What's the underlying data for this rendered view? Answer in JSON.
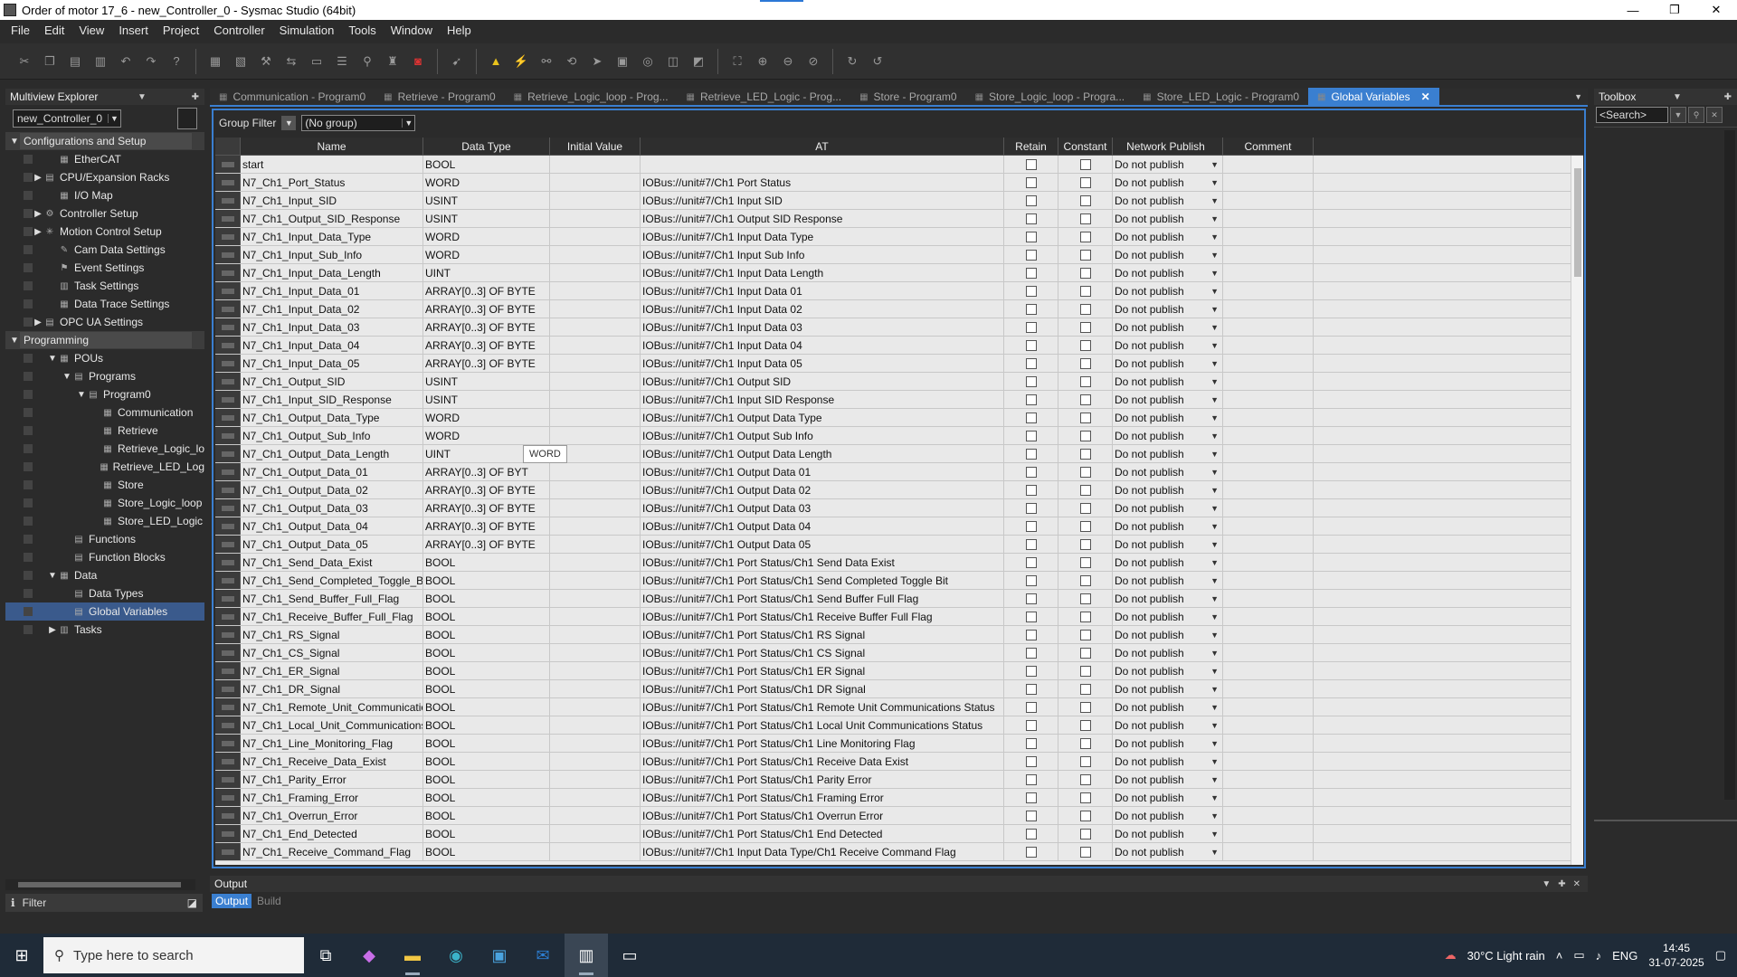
{
  "window": {
    "title": "Order of motor 17_6 - new_Controller_0 - Sysmac Studio (64bit)",
    "minimize": "—",
    "maximize": "❐",
    "close": "✕"
  },
  "menu": [
    "File",
    "Edit",
    "View",
    "Insert",
    "Project",
    "Controller",
    "Simulation",
    "Tools",
    "Window",
    "Help"
  ],
  "explorer": {
    "title": "Multiview Explorer",
    "controller": "new_Controller_0",
    "tree": [
      {
        "label": "Configurations and Setup",
        "level": 0,
        "arrow": "▼",
        "section": true,
        "icon": ""
      },
      {
        "label": "EtherCAT",
        "level": 2,
        "arrow": "",
        "icon": "▦"
      },
      {
        "label": "CPU/Expansion Racks",
        "level": 1,
        "arrow": "▶",
        "icon": "▤"
      },
      {
        "label": "I/O Map",
        "level": 2,
        "arrow": "",
        "icon": "▦"
      },
      {
        "label": "Controller Setup",
        "level": 1,
        "arrow": "▶",
        "icon": "⚙"
      },
      {
        "label": "Motion Control Setup",
        "level": 1,
        "arrow": "▶",
        "icon": "✳"
      },
      {
        "label": "Cam Data Settings",
        "level": 2,
        "arrow": "",
        "icon": "✎"
      },
      {
        "label": "Event Settings",
        "level": 2,
        "arrow": "",
        "icon": "⚑"
      },
      {
        "label": "Task Settings",
        "level": 2,
        "arrow": "",
        "icon": "▥"
      },
      {
        "label": "Data Trace Settings",
        "level": 2,
        "arrow": "",
        "icon": "▦"
      },
      {
        "label": "OPC UA Settings",
        "level": 1,
        "arrow": "▶",
        "icon": "▤"
      },
      {
        "label": "Programming",
        "level": 0,
        "arrow": "▼",
        "section": true,
        "icon": ""
      },
      {
        "label": "POUs",
        "level": 2,
        "arrow": "▼",
        "icon": "▦"
      },
      {
        "label": "Programs",
        "level": 3,
        "arrow": "▼",
        "icon": "▤"
      },
      {
        "label": "Program0",
        "level": 4,
        "arrow": "▼",
        "icon": "▤"
      },
      {
        "label": "Communication",
        "level": 5,
        "arrow": "",
        "icon": "▦"
      },
      {
        "label": "Retrieve",
        "level": 5,
        "arrow": "",
        "icon": "▦"
      },
      {
        "label": "Retrieve_Logic_lo",
        "level": 5,
        "arrow": "",
        "icon": "▦"
      },
      {
        "label": "Retrieve_LED_Log",
        "level": 5,
        "arrow": "",
        "icon": "▦"
      },
      {
        "label": "Store",
        "level": 5,
        "arrow": "",
        "icon": "▦"
      },
      {
        "label": "Store_Logic_loop",
        "level": 5,
        "arrow": "",
        "icon": "▦"
      },
      {
        "label": "Store_LED_Logic",
        "level": 5,
        "arrow": "",
        "icon": "▦"
      },
      {
        "label": "Functions",
        "level": 3,
        "arrow": "",
        "icon": "▤"
      },
      {
        "label": "Function Blocks",
        "level": 3,
        "arrow": "",
        "icon": "▤"
      },
      {
        "label": "Data",
        "level": 2,
        "arrow": "▼",
        "icon": "▦"
      },
      {
        "label": "Data Types",
        "level": 3,
        "arrow": "",
        "icon": "▤"
      },
      {
        "label": "Global Variables",
        "level": 3,
        "arrow": "",
        "icon": "▤",
        "selected": true
      },
      {
        "label": "Tasks",
        "level": 2,
        "arrow": "▶",
        "icon": "▥"
      }
    ],
    "filter": "Filter"
  },
  "tabs": [
    {
      "label": "Communication - Program0",
      "active": false
    },
    {
      "label": "Retrieve - Program0",
      "active": false
    },
    {
      "label": "Retrieve_Logic_loop - Prog...",
      "active": false
    },
    {
      "label": "Retrieve_LED_Logic - Prog...",
      "active": false
    },
    {
      "label": "Store - Program0",
      "active": false
    },
    {
      "label": "Store_Logic_loop - Progra...",
      "active": false
    },
    {
      "label": "Store_LED_Logic - Program0",
      "active": false
    },
    {
      "label": "Global Variables",
      "active": true
    }
  ],
  "group_filter": {
    "label": "Group Filter",
    "value": "(No group)"
  },
  "columns": [
    "Name",
    "Data Type",
    "Initial Value",
    "AT",
    "Retain",
    "Constant",
    "Network Publish",
    "Comment"
  ],
  "rows": [
    {
      "name": "start",
      "type": "BOOL",
      "at": ""
    },
    {
      "name": "N7_Ch1_Port_Status",
      "type": "WORD",
      "at": "IOBus://unit#7/Ch1 Port Status"
    },
    {
      "name": "N7_Ch1_Input_SID",
      "type": "USINT",
      "at": "IOBus://unit#7/Ch1 Input SID"
    },
    {
      "name": "N7_Ch1_Output_SID_Response",
      "type": "USINT",
      "at": "IOBus://unit#7/Ch1 Output SID Response"
    },
    {
      "name": "N7_Ch1_Input_Data_Type",
      "type": "WORD",
      "at": "IOBus://unit#7/Ch1 Input Data Type"
    },
    {
      "name": "N7_Ch1_Input_Sub_Info",
      "type": "WORD",
      "at": "IOBus://unit#7/Ch1 Input Sub Info"
    },
    {
      "name": "N7_Ch1_Input_Data_Length",
      "type": "UINT",
      "at": "IOBus://unit#7/Ch1 Input Data Length"
    },
    {
      "name": "N7_Ch1_Input_Data_01",
      "type": "ARRAY[0..3] OF BYTE",
      "at": "IOBus://unit#7/Ch1 Input Data 01"
    },
    {
      "name": "N7_Ch1_Input_Data_02",
      "type": "ARRAY[0..3] OF BYTE",
      "at": "IOBus://unit#7/Ch1 Input Data 02"
    },
    {
      "name": "N7_Ch1_Input_Data_03",
      "type": "ARRAY[0..3] OF BYTE",
      "at": "IOBus://unit#7/Ch1 Input Data 03"
    },
    {
      "name": "N7_Ch1_Input_Data_04",
      "type": "ARRAY[0..3] OF BYTE",
      "at": "IOBus://unit#7/Ch1 Input Data 04"
    },
    {
      "name": "N7_Ch1_Input_Data_05",
      "type": "ARRAY[0..3] OF BYTE",
      "at": "IOBus://unit#7/Ch1 Input Data 05"
    },
    {
      "name": "N7_Ch1_Output_SID",
      "type": "USINT",
      "at": "IOBus://unit#7/Ch1 Output SID"
    },
    {
      "name": "N7_Ch1_Input_SID_Response",
      "type": "USINT",
      "at": "IOBus://unit#7/Ch1 Input SID Response"
    },
    {
      "name": "N7_Ch1_Output_Data_Type",
      "type": "WORD",
      "at": "IOBus://unit#7/Ch1 Output Data Type"
    },
    {
      "name": "N7_Ch1_Output_Sub_Info",
      "type": "WORD",
      "at": "IOBus://unit#7/Ch1 Output Sub Info"
    },
    {
      "name": "N7_Ch1_Output_Data_Length",
      "type": "UINT",
      "at": "IOBus://unit#7/Ch1 Output Data Length"
    },
    {
      "name": "N7_Ch1_Output_Data_01",
      "type": "ARRAY[0..3] OF BYT",
      "at": "IOBus://unit#7/Ch1 Output Data 01"
    },
    {
      "name": "N7_Ch1_Output_Data_02",
      "type": "ARRAY[0..3] OF BYTE",
      "at": "IOBus://unit#7/Ch1 Output Data 02"
    },
    {
      "name": "N7_Ch1_Output_Data_03",
      "type": "ARRAY[0..3] OF BYTE",
      "at": "IOBus://unit#7/Ch1 Output Data 03"
    },
    {
      "name": "N7_Ch1_Output_Data_04",
      "type": "ARRAY[0..3] OF BYTE",
      "at": "IOBus://unit#7/Ch1 Output Data 04"
    },
    {
      "name": "N7_Ch1_Output_Data_05",
      "type": "ARRAY[0..3] OF BYTE",
      "at": "IOBus://unit#7/Ch1 Output Data 05"
    },
    {
      "name": "N7_Ch1_Send_Data_Exist",
      "type": "BOOL",
      "at": "IOBus://unit#7/Ch1 Port Status/Ch1 Send Data Exist"
    },
    {
      "name": "N7_Ch1_Send_Completed_Toggle_Bit",
      "type": "BOOL",
      "at": "IOBus://unit#7/Ch1 Port Status/Ch1 Send Completed Toggle Bit"
    },
    {
      "name": "N7_Ch1_Send_Buffer_Full_Flag",
      "type": "BOOL",
      "at": "IOBus://unit#7/Ch1 Port Status/Ch1 Send Buffer Full Flag"
    },
    {
      "name": "N7_Ch1_Receive_Buffer_Full_Flag",
      "type": "BOOL",
      "at": "IOBus://unit#7/Ch1 Port Status/Ch1 Receive Buffer Full Flag"
    },
    {
      "name": "N7_Ch1_RS_Signal",
      "type": "BOOL",
      "at": "IOBus://unit#7/Ch1 Port Status/Ch1 RS Signal"
    },
    {
      "name": "N7_Ch1_CS_Signal",
      "type": "BOOL",
      "at": "IOBus://unit#7/Ch1 Port Status/Ch1 CS Signal"
    },
    {
      "name": "N7_Ch1_ER_Signal",
      "type": "BOOL",
      "at": "IOBus://unit#7/Ch1 Port Status/Ch1 ER Signal"
    },
    {
      "name": "N7_Ch1_DR_Signal",
      "type": "BOOL",
      "at": "IOBus://unit#7/Ch1 Port Status/Ch1 DR Signal"
    },
    {
      "name": "N7_Ch1_Remote_Unit_Communicatio",
      "type": "BOOL",
      "at": "IOBus://unit#7/Ch1 Port Status/Ch1 Remote Unit Communications Status"
    },
    {
      "name": "N7_Ch1_Local_Unit_Communications_",
      "type": "BOOL",
      "at": "IOBus://unit#7/Ch1 Port Status/Ch1 Local Unit Communications Status"
    },
    {
      "name": "N7_Ch1_Line_Monitoring_Flag",
      "type": "BOOL",
      "at": "IOBus://unit#7/Ch1 Port Status/Ch1 Line Monitoring Flag"
    },
    {
      "name": "N7_Ch1_Receive_Data_Exist",
      "type": "BOOL",
      "at": "IOBus://unit#7/Ch1 Port Status/Ch1 Receive Data Exist"
    },
    {
      "name": "N7_Ch1_Parity_Error",
      "type": "BOOL",
      "at": "IOBus://unit#7/Ch1 Port Status/Ch1 Parity Error"
    },
    {
      "name": "N7_Ch1_Framing_Error",
      "type": "BOOL",
      "at": "IOBus://unit#7/Ch1 Port Status/Ch1 Framing Error"
    },
    {
      "name": "N7_Ch1_Overrun_Error",
      "type": "BOOL",
      "at": "IOBus://unit#7/Ch1 Port Status/Ch1 Overrun Error"
    },
    {
      "name": "N7_Ch1_End_Detected",
      "type": "BOOL",
      "at": "IOBus://unit#7/Ch1 Port Status/Ch1 End Detected"
    },
    {
      "name": "N7_Ch1_Receive_Command_Flag",
      "type": "BOOL",
      "at": "IOBus://unit#7/Ch1 Input Data Type/Ch1 Receive Command Flag"
    }
  ],
  "publish_value": "Do not publish",
  "tooltip": "WORD",
  "output": {
    "title": "Output",
    "tabs": [
      "Output",
      "Build"
    ]
  },
  "toolbox": {
    "title": "Toolbox",
    "search": "<Search>"
  },
  "taskbar": {
    "search_placeholder": "Type here to search",
    "weather": "30°C  Light rain",
    "lang": "ENG",
    "time": "14:45",
    "date": "31-07-2025"
  },
  "colors": {
    "accent": "#3a7fd0",
    "selected": "#3a5a8c",
    "grid_bg": "#e9e9e9"
  }
}
